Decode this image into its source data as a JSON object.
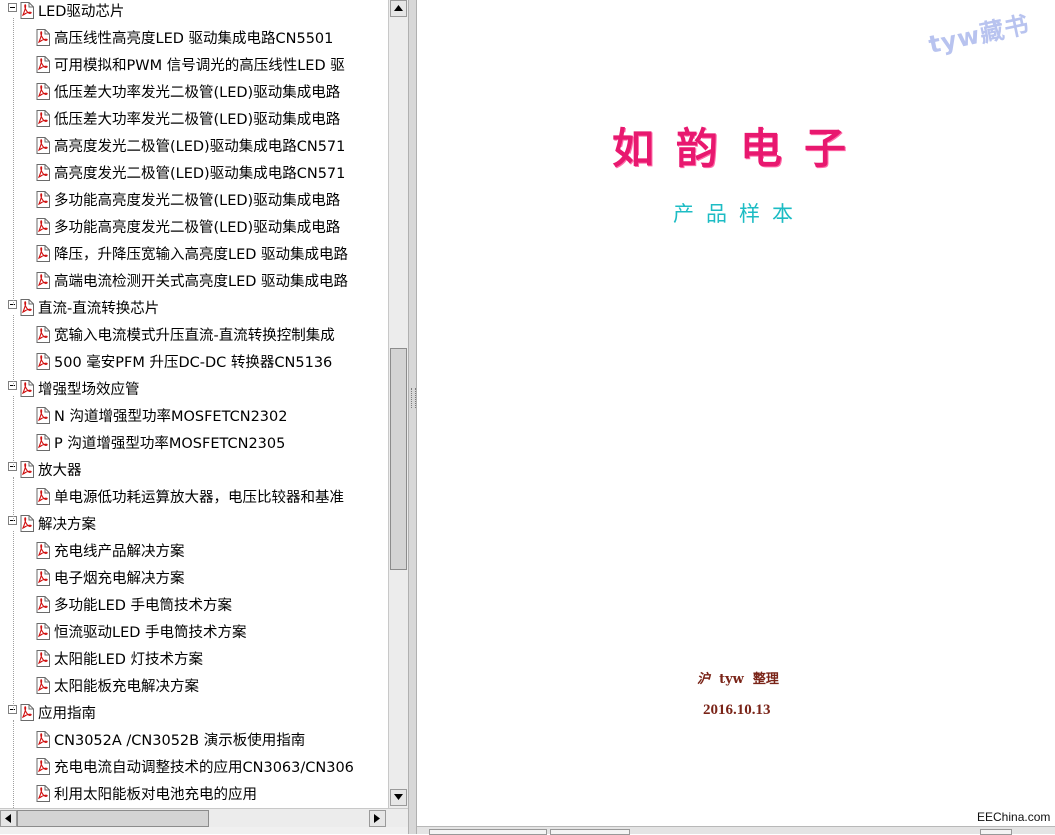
{
  "tree": [
    {
      "type": "category",
      "label": "LED驱动芯片"
    },
    {
      "type": "doc",
      "label": "高压线性高亮度LED 驱动集成电路CN5501"
    },
    {
      "type": "doc",
      "label": "可用模拟和PWM 信号调光的高压线性LED 驱"
    },
    {
      "type": "doc",
      "label": "低压差大功率发光二极管(LED)驱动集成电路"
    },
    {
      "type": "doc",
      "label": "低压差大功率发光二极管(LED)驱动集成电路"
    },
    {
      "type": "doc",
      "label": "高亮度发光二极管(LED)驱动集成电路CN571"
    },
    {
      "type": "doc",
      "label": "高亮度发光二极管(LED)驱动集成电路CN571"
    },
    {
      "type": "doc",
      "label": "多功能高亮度发光二极管(LED)驱动集成电路"
    },
    {
      "type": "doc",
      "label": "多功能高亮度发光二极管(LED)驱动集成电路"
    },
    {
      "type": "doc",
      "label": "降压，升降压宽输入高亮度LED 驱动集成电路"
    },
    {
      "type": "doc",
      "label": "高端电流检测开关式高亮度LED 驱动集成电路"
    },
    {
      "type": "category",
      "label": "直流-直流转换芯片"
    },
    {
      "type": "doc",
      "label": "宽输入电流模式升压直流-直流转换控制集成"
    },
    {
      "type": "doc",
      "label": "500 毫安PFM 升压DC-DC 转换器CN5136"
    },
    {
      "type": "category",
      "label": "增强型场效应管"
    },
    {
      "type": "doc",
      "label": "N 沟道增强型功率MOSFETCN2302"
    },
    {
      "type": "doc",
      "label": "P 沟道增强型功率MOSFETCN2305"
    },
    {
      "type": "category",
      "label": "放大器"
    },
    {
      "type": "doc",
      "label": "单电源低功耗运算放大器，电压比较器和基准"
    },
    {
      "type": "category",
      "label": "解决方案"
    },
    {
      "type": "doc",
      "label": "充电线产品解决方案"
    },
    {
      "type": "doc",
      "label": "电子烟充电解决方案"
    },
    {
      "type": "doc",
      "label": "多功能LED 手电筒技术方案"
    },
    {
      "type": "doc",
      "label": "恒流驱动LED 手电筒技术方案"
    },
    {
      "type": "doc",
      "label": "太阳能LED 灯技术方案"
    },
    {
      "type": "doc",
      "label": "太阳能板充电解决方案"
    },
    {
      "type": "category",
      "label": "应用指南"
    },
    {
      "type": "doc",
      "label": "CN3052A /CN3052B 演示板使用指南"
    },
    {
      "type": "doc",
      "label": "充电电流自动调整技术的应用CN3063/CN306"
    },
    {
      "type": "doc",
      "label": "利用太阳能板对电池充电的应用"
    }
  ],
  "document": {
    "watermark": "tyw藏书",
    "company_name": "如韵电子",
    "catalog_title": "产品样本",
    "compiled_by_prefix": "沪",
    "compiled_by_name": "tyw",
    "compiled_by_suffix": "整理",
    "date": "2016.10.13",
    "site_credit": "EEChina.com"
  },
  "scroll": {
    "vertical_thumb_fraction": 0.6,
    "horizontal_thumb_fraction": 0.0
  },
  "colors": {
    "company_name": "#e8186f",
    "catalog_title": "#1dbcc4",
    "compiled_text": "#7a2418",
    "watermark": "#b8c3ef",
    "pdf_icon": "#d01010"
  }
}
